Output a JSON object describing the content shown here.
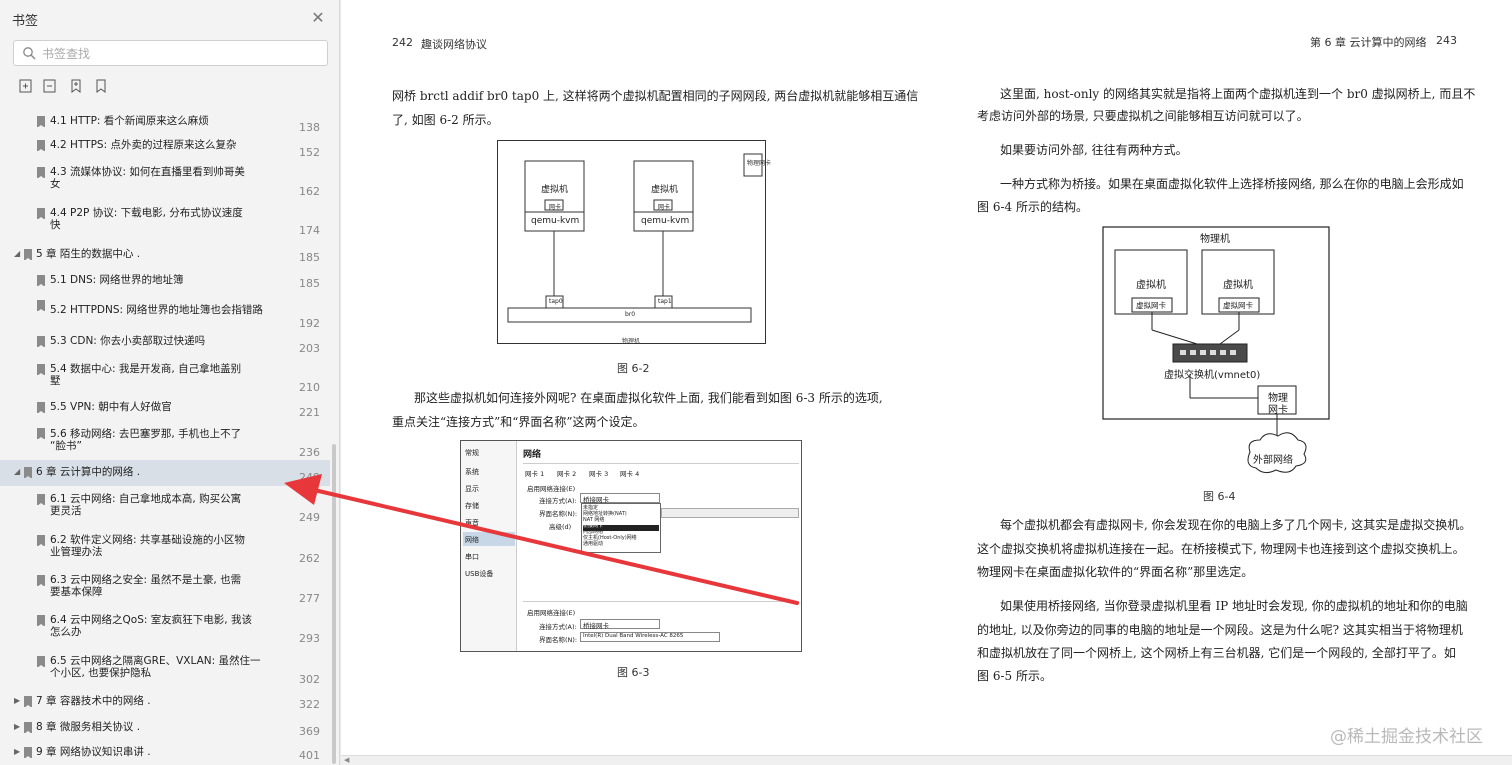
{
  "sidebar": {
    "title": "书签",
    "close_icon": "close-icon",
    "search_placeholder": "书签查找",
    "tools": [
      "expand-all-icon",
      "collapse-all-icon",
      "add-bookmark-icon",
      "bookmark-icon"
    ],
    "items": [
      {
        "label": "4.1 HTTP: 看个新闻原来这么麻烦",
        "page": "138",
        "level": 2
      },
      {
        "label": "4.2 HTTPS: 点外卖的过程原来这么复杂",
        "page": "152",
        "level": 2
      },
      {
        "label": "4.3 流媒体协议: 如何在直播里看到帅哥美",
        "label2": "女",
        "page": "162",
        "level": 2
      },
      {
        "label": "4.4 P2P 协议: 下载电影, 分布式协议速度",
        "label2": "快",
        "page": "174",
        "level": 2
      },
      {
        "label": "5 章  陌生的数据中心 .",
        "page": "185",
        "level": 1
      },
      {
        "label": "5.1 DNS: 网络世界的地址簿",
        "page": "185",
        "level": 2
      },
      {
        "label": "5.2 HTTPDNS: 网络世界的地址簿也会指错路",
        "page": "192",
        "level": 2
      },
      {
        "label": "5.3 CDN: 你去小卖部取过快递吗",
        "page": "203",
        "level": 2
      },
      {
        "label": "5.4 数据中心: 我是开发商, 自己拿地盖别",
        "label2": "墅",
        "page": "210",
        "level": 2
      },
      {
        "label": "5.5 VPN: 朝中有人好做官",
        "page": "221",
        "level": 2
      },
      {
        "label": "5.6 移动网络: 去巴塞罗那, 手机也上不了",
        "label2": "“脸书”",
        "page": "236",
        "level": 2
      },
      {
        "label": "6 章  云计算中的网络 .",
        "page": "249",
        "level": 1
      },
      {
        "label": "6.1 云中网络: 自己拿地成本高, 购买公寓",
        "label2": "更灵活",
        "page": "249",
        "level": 2
      },
      {
        "label": "6.2 软件定义网络: 共享基础设施的小区物",
        "label2": "业管理办法",
        "page": "262",
        "level": 2
      },
      {
        "label": "6.3 云中网络之安全: 虽然不是土豪, 也需",
        "label2": "要基本保障",
        "page": "277",
        "level": 2
      },
      {
        "label": "6.4 云中网络之QoS: 室友疯狂下电影, 我该",
        "label2": "怎么办",
        "page": "293",
        "level": 2
      },
      {
        "label": "6.5 云中网络之隔离GRE、VXLAN: 虽然住一",
        "label2": "个小区, 也要保护隐私",
        "page": "302",
        "level": 2
      },
      {
        "label": "7 章  容器技术中的网络 .",
        "page": "322",
        "level": 1
      },
      {
        "label": "8 章  微服务相关协议 .",
        "page": "369",
        "level": 1
      },
      {
        "label": "9 章  网络协议知识串讲 .",
        "page": "401",
        "level": 1
      }
    ]
  },
  "left_page": {
    "header_num": "242",
    "header_title": "趣谈网络协议",
    "para1_l1": "网桥 brctl addif br0 tap0 上, 这样将两个虚拟机配置相同的子网网段, 两台虚拟机就能够相互通信",
    "para1_l2": "了, 如图 6-2 所示。",
    "fig2": {
      "phys_label": "物理网卡",
      "vm_label": "虚拟机",
      "nic_label": "网卡",
      "qemu_label": "qemu-kvm",
      "tap0": "tap0",
      "tap1": "tap1",
      "br0": "br0",
      "host_label": "物理机",
      "caption": "图 6-2"
    },
    "para2_l1": "那这些虚拟机如何连接外网呢? 在桌面虚拟化软件上面, 我们能看到如图 6-3 所示的选项,",
    "para2_l2": "重点关注“连接方式”和“界面名称”这两个设定。",
    "fig3": {
      "menu": [
        "常规",
        "系统",
        "显示",
        "存储",
        "声音",
        "网络",
        "串口",
        "USB设备"
      ],
      "title": "网络",
      "tabs": [
        "网卡 1",
        "网卡 2",
        "网卡 3",
        "网卡 4"
      ],
      "enable": "启用网络连接(E)",
      "conn_label": "连接方式(A):",
      "conn_value": "桥接网卡",
      "iface_label": "界面名称(N):",
      "iface_value": "Intel(R) Dual Band Wireless-AC 8265",
      "adv": "高级(d)",
      "options": [
        "未指定",
        "网络地址转换(NAT)",
        "NAT 网络",
        "桥接网卡",
        "内部网络",
        "仅主机(Host-Only)网络",
        "通用驱动"
      ],
      "caption": "图 6-3"
    }
  },
  "right_page": {
    "header_chapter": "第 6 章  云计算中的网络",
    "header_num": "243",
    "p1_l1": "这里面, host-only 的网络其实就是指将上面两个虚拟机连到一个 br0 虚拟网桥上, 而且不",
    "p1_l2": "考虑访问外部的场景, 只要虚拟机之间能够相互访问就可以了。",
    "p2": "如果要访问外部, 往往有两种方式。",
    "p3_l1": "一种方式称为桥接。如果在桌面虚拟化软件上选择桥接网络, 那么在你的电脑上会形成如",
    "p3_l2": "图 6-4 所示的结构。",
    "fig4": {
      "host": "物理机",
      "vm": "虚拟机",
      "vnic": "虚拟网卡",
      "switch": "虚拟交换机(vmnet0)",
      "pnic1": "物理",
      "pnic2": "网卡",
      "ext": "外部网络",
      "caption": "图 6-4"
    },
    "p4_l1": "每个虚拟机都会有虚拟网卡, 你会发现在你的电脑上多了几个网卡, 这其实是虚拟交换机。",
    "p4_l2": "这个虚拟交换机将虚拟机连接在一起。在桥接模式下, 物理网卡也连接到这个虚拟交换机上。",
    "p4_l3": "物理网卡在桌面虚拟化软件的“界面名称”那里选定。",
    "p5_l1": "如果使用桥接网络, 当你登录虚拟机里看 IP 地址时会发现, 你的虚拟机的地址和你的电脑",
    "p5_l2": "的地址, 以及你旁边的同事的电脑的地址是一个网段。这是为什么呢? 这其实相当于将物理机",
    "p5_l3": "和虚拟机放在了同一个网桥上, 这个网桥上有三台机器, 它们是一个网段的, 全部打平了。如",
    "p5_l4": "图 6-5 所示。"
  },
  "watermark": "@稀土掘金技术社区",
  "colors": {
    "arrow": "#e8373a",
    "selected": "#d9dfe6"
  }
}
